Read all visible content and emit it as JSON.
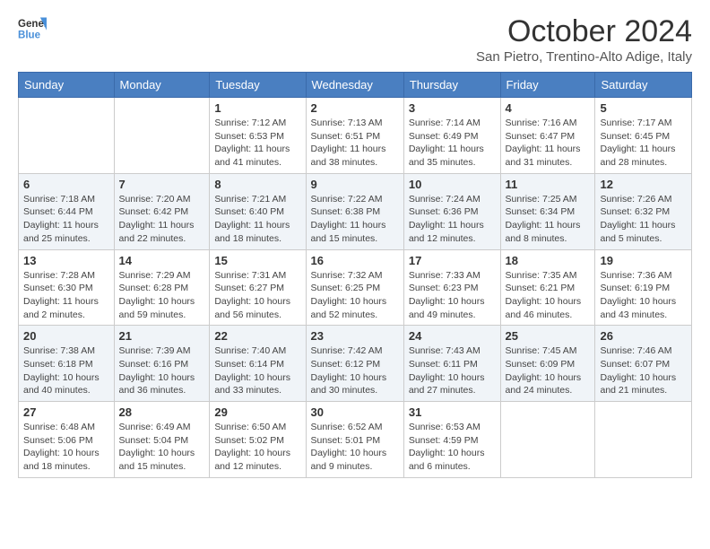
{
  "header": {
    "logo_general": "General",
    "logo_blue": "Blue",
    "month_title": "October 2024",
    "location": "San Pietro, Trentino-Alto Adige, Italy"
  },
  "days_of_week": [
    "Sunday",
    "Monday",
    "Tuesday",
    "Wednesday",
    "Thursday",
    "Friday",
    "Saturday"
  ],
  "weeks": [
    [
      {
        "day": "",
        "detail": ""
      },
      {
        "day": "",
        "detail": ""
      },
      {
        "day": "1",
        "detail": "Sunrise: 7:12 AM\nSunset: 6:53 PM\nDaylight: 11 hours and 41 minutes."
      },
      {
        "day": "2",
        "detail": "Sunrise: 7:13 AM\nSunset: 6:51 PM\nDaylight: 11 hours and 38 minutes."
      },
      {
        "day": "3",
        "detail": "Sunrise: 7:14 AM\nSunset: 6:49 PM\nDaylight: 11 hours and 35 minutes."
      },
      {
        "day": "4",
        "detail": "Sunrise: 7:16 AM\nSunset: 6:47 PM\nDaylight: 11 hours and 31 minutes."
      },
      {
        "day": "5",
        "detail": "Sunrise: 7:17 AM\nSunset: 6:45 PM\nDaylight: 11 hours and 28 minutes."
      }
    ],
    [
      {
        "day": "6",
        "detail": "Sunrise: 7:18 AM\nSunset: 6:44 PM\nDaylight: 11 hours and 25 minutes."
      },
      {
        "day": "7",
        "detail": "Sunrise: 7:20 AM\nSunset: 6:42 PM\nDaylight: 11 hours and 22 minutes."
      },
      {
        "day": "8",
        "detail": "Sunrise: 7:21 AM\nSunset: 6:40 PM\nDaylight: 11 hours and 18 minutes."
      },
      {
        "day": "9",
        "detail": "Sunrise: 7:22 AM\nSunset: 6:38 PM\nDaylight: 11 hours and 15 minutes."
      },
      {
        "day": "10",
        "detail": "Sunrise: 7:24 AM\nSunset: 6:36 PM\nDaylight: 11 hours and 12 minutes."
      },
      {
        "day": "11",
        "detail": "Sunrise: 7:25 AM\nSunset: 6:34 PM\nDaylight: 11 hours and 8 minutes."
      },
      {
        "day": "12",
        "detail": "Sunrise: 7:26 AM\nSunset: 6:32 PM\nDaylight: 11 hours and 5 minutes."
      }
    ],
    [
      {
        "day": "13",
        "detail": "Sunrise: 7:28 AM\nSunset: 6:30 PM\nDaylight: 11 hours and 2 minutes."
      },
      {
        "day": "14",
        "detail": "Sunrise: 7:29 AM\nSunset: 6:28 PM\nDaylight: 10 hours and 59 minutes."
      },
      {
        "day": "15",
        "detail": "Sunrise: 7:31 AM\nSunset: 6:27 PM\nDaylight: 10 hours and 56 minutes."
      },
      {
        "day": "16",
        "detail": "Sunrise: 7:32 AM\nSunset: 6:25 PM\nDaylight: 10 hours and 52 minutes."
      },
      {
        "day": "17",
        "detail": "Sunrise: 7:33 AM\nSunset: 6:23 PM\nDaylight: 10 hours and 49 minutes."
      },
      {
        "day": "18",
        "detail": "Sunrise: 7:35 AM\nSunset: 6:21 PM\nDaylight: 10 hours and 46 minutes."
      },
      {
        "day": "19",
        "detail": "Sunrise: 7:36 AM\nSunset: 6:19 PM\nDaylight: 10 hours and 43 minutes."
      }
    ],
    [
      {
        "day": "20",
        "detail": "Sunrise: 7:38 AM\nSunset: 6:18 PM\nDaylight: 10 hours and 40 minutes."
      },
      {
        "day": "21",
        "detail": "Sunrise: 7:39 AM\nSunset: 6:16 PM\nDaylight: 10 hours and 36 minutes."
      },
      {
        "day": "22",
        "detail": "Sunrise: 7:40 AM\nSunset: 6:14 PM\nDaylight: 10 hours and 33 minutes."
      },
      {
        "day": "23",
        "detail": "Sunrise: 7:42 AM\nSunset: 6:12 PM\nDaylight: 10 hours and 30 minutes."
      },
      {
        "day": "24",
        "detail": "Sunrise: 7:43 AM\nSunset: 6:11 PM\nDaylight: 10 hours and 27 minutes."
      },
      {
        "day": "25",
        "detail": "Sunrise: 7:45 AM\nSunset: 6:09 PM\nDaylight: 10 hours and 24 minutes."
      },
      {
        "day": "26",
        "detail": "Sunrise: 7:46 AM\nSunset: 6:07 PM\nDaylight: 10 hours and 21 minutes."
      }
    ],
    [
      {
        "day": "27",
        "detail": "Sunrise: 6:48 AM\nSunset: 5:06 PM\nDaylight: 10 hours and 18 minutes."
      },
      {
        "day": "28",
        "detail": "Sunrise: 6:49 AM\nSunset: 5:04 PM\nDaylight: 10 hours and 15 minutes."
      },
      {
        "day": "29",
        "detail": "Sunrise: 6:50 AM\nSunset: 5:02 PM\nDaylight: 10 hours and 12 minutes."
      },
      {
        "day": "30",
        "detail": "Sunrise: 6:52 AM\nSunset: 5:01 PM\nDaylight: 10 hours and 9 minutes."
      },
      {
        "day": "31",
        "detail": "Sunrise: 6:53 AM\nSunset: 4:59 PM\nDaylight: 10 hours and 6 minutes."
      },
      {
        "day": "",
        "detail": ""
      },
      {
        "day": "",
        "detail": ""
      }
    ]
  ]
}
